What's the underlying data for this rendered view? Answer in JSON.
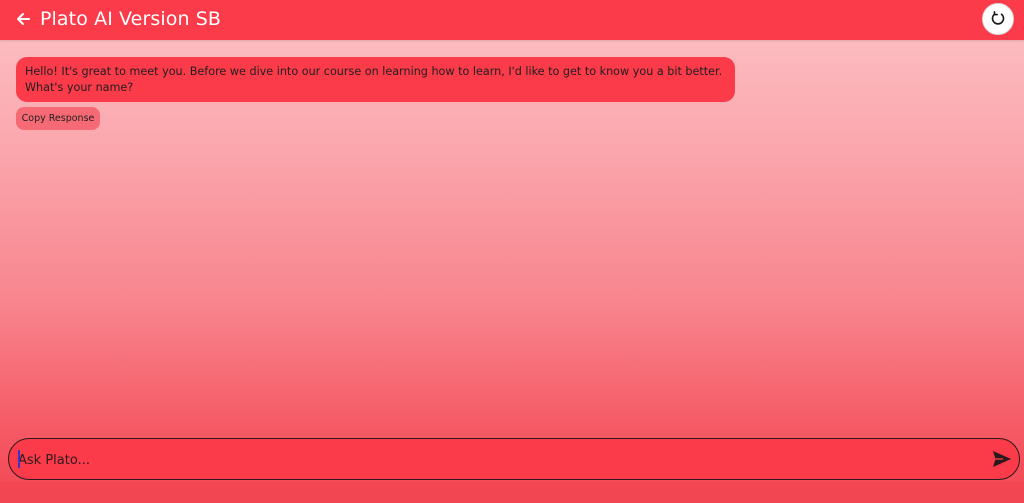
{
  "app_bar": {
    "title": "Plato AI Version SB",
    "back_icon": "arrow-left-icon",
    "reset_icon": "refresh-icon",
    "background_color": "#fb3a4a"
  },
  "messages": [
    {
      "role": "assistant",
      "text": "Hello! It's great to meet you. Before we dive into our course on learning how to learn, I'd like to get to know you a bit better. What's your name?",
      "copy_label": "Copy Response"
    }
  ],
  "composer": {
    "placeholder": "Ask Plato...",
    "value": "",
    "send_icon": "send-icon"
  }
}
